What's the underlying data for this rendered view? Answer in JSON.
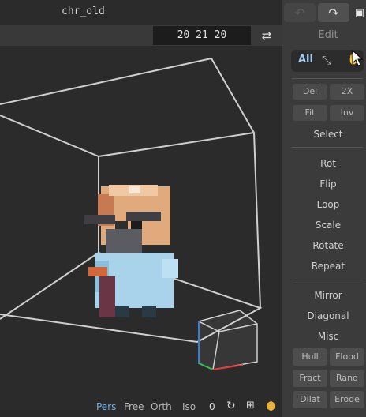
{
  "window": {
    "title": "chr_old"
  },
  "viewport": {
    "dimensions": "20 21 20",
    "swap_icon": "swap-arrows-icon"
  },
  "camera_bar": {
    "modes": [
      "Pers",
      "Free",
      "Orth",
      "Iso"
    ],
    "active_mode": "Pers",
    "counter": "0",
    "icons": [
      "rotate-icon",
      "frame-icon",
      "cube-icon"
    ]
  },
  "panel": {
    "undo_icon": "undo-icon",
    "redo_icon": "redo-icon",
    "save_icon": "save-icon",
    "section_title": "Edit",
    "selection_toggle": {
      "all_label": "All",
      "fit_icon": "fit-arrows-icon",
      "hand_icon": "hand-icon"
    },
    "grid_buttons_top": [
      {
        "label": "Del"
      },
      {
        "label": "2X"
      },
      {
        "label": "Fit"
      },
      {
        "label": "Inv"
      }
    ],
    "select_label": "Select",
    "transform_items": [
      "Rot",
      "Flip",
      "Loop",
      "Scale",
      "Rotate",
      "Repeat"
    ],
    "mirror_items": [
      "Mirror",
      "Diagonal",
      "Misc"
    ],
    "grid_buttons_bottom": [
      {
        "label": "Hull"
      },
      {
        "label": "Flood"
      },
      {
        "label": "Fract"
      },
      {
        "label": "Rand"
      },
      {
        "label": "Dilat"
      },
      {
        "label": "Erode"
      }
    ]
  },
  "colors": {
    "accent": "#6fb0e6",
    "background": "#2b2b2b",
    "panel": "#3b3b3b"
  }
}
